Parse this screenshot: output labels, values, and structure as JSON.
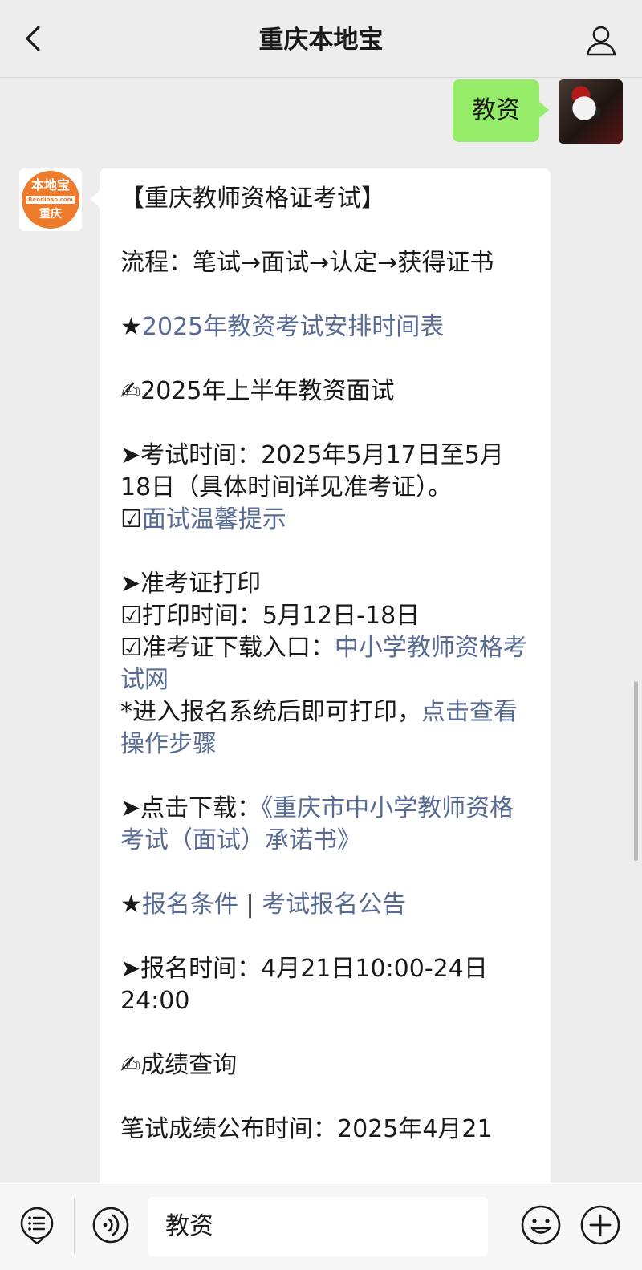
{
  "header": {
    "title": "重庆本地宝",
    "back_icon": "chevron-left-icon",
    "profile_icon": "person-icon"
  },
  "outgoing_message": {
    "text": "教资"
  },
  "bot_avatar": {
    "logo_top": "本地宝",
    "logo_mid": "Bendibao.com",
    "logo_bottom": "重庆"
  },
  "reply": {
    "heading": "【重庆教师资格证考试】",
    "process": "流程：笔试→面试→认定→获得证书",
    "star_1": "★",
    "schedule_link": "2025年教资考试安排时间表",
    "interview_title": "✍2025年上半年教资面试",
    "exam_time": "➤考试时间：2025年5月17日至5月18日（具体时间详见准考证）。",
    "check_1": "☑",
    "tips_link": "面试温馨提示",
    "admission_title": "➤准考证打印",
    "print_time": "☑打印时间：5月12日-18日",
    "download_prefix": "☑准考证下载入口：",
    "download_link": "中小学教师资格考试网",
    "note_prefix": "*进入报名系统后即可打印，",
    "note_link": "点击查看操作步骤",
    "click_download_prefix": "➤点击下载：",
    "commitment_link": "《重庆市中小学教师资格考试（面试）承诺书》",
    "star_2": "★",
    "conditions_link": "报名条件",
    "separator": " | ",
    "notice_link": "考试报名公告",
    "registration_time": "➤报名时间：4月21日10:00-24日24:00",
    "score_title": "✍成绩查询",
    "written_score": "笔试成绩公布时间：2025年4月21"
  },
  "footer": {
    "input_value": "教资",
    "menu_icon": "menu-list-icon",
    "voice_icon": "voice-icon",
    "emoji_icon": "emoji-icon",
    "plus_icon": "plus-icon"
  },
  "colors": {
    "background": "#ededed",
    "outgoing_bubble": "#95ec69",
    "link": "#576b95",
    "logo_orange": "#ee7a2c"
  }
}
